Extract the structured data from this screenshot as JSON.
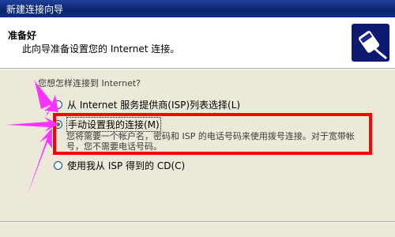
{
  "window": {
    "title": "新建连接向导"
  },
  "header": {
    "title": "准备好",
    "subtitle": "此向导准备设置您的 Internet 连接。",
    "logo_icon": "network-cable-icon"
  },
  "question": "您想怎样连接到 Internet?",
  "options": [
    {
      "label": "从 Internet 服务提供商(ISP)列表选择(L)",
      "checked": false
    },
    {
      "label": "手动设置我的连接(M)",
      "checked": true
    },
    {
      "label": "使用我从 ISP 得到的 CD(C)",
      "checked": false
    }
  ],
  "manual_description": "您将需要一个帐户名，密码和 ISP 的电话号码来使用拨号连接。对于宽带帐号，您不需要电话号码。",
  "colors": {
    "highlight": "#ff0000",
    "arrow": "#ff33ff",
    "titlebar": "#0a246a"
  }
}
